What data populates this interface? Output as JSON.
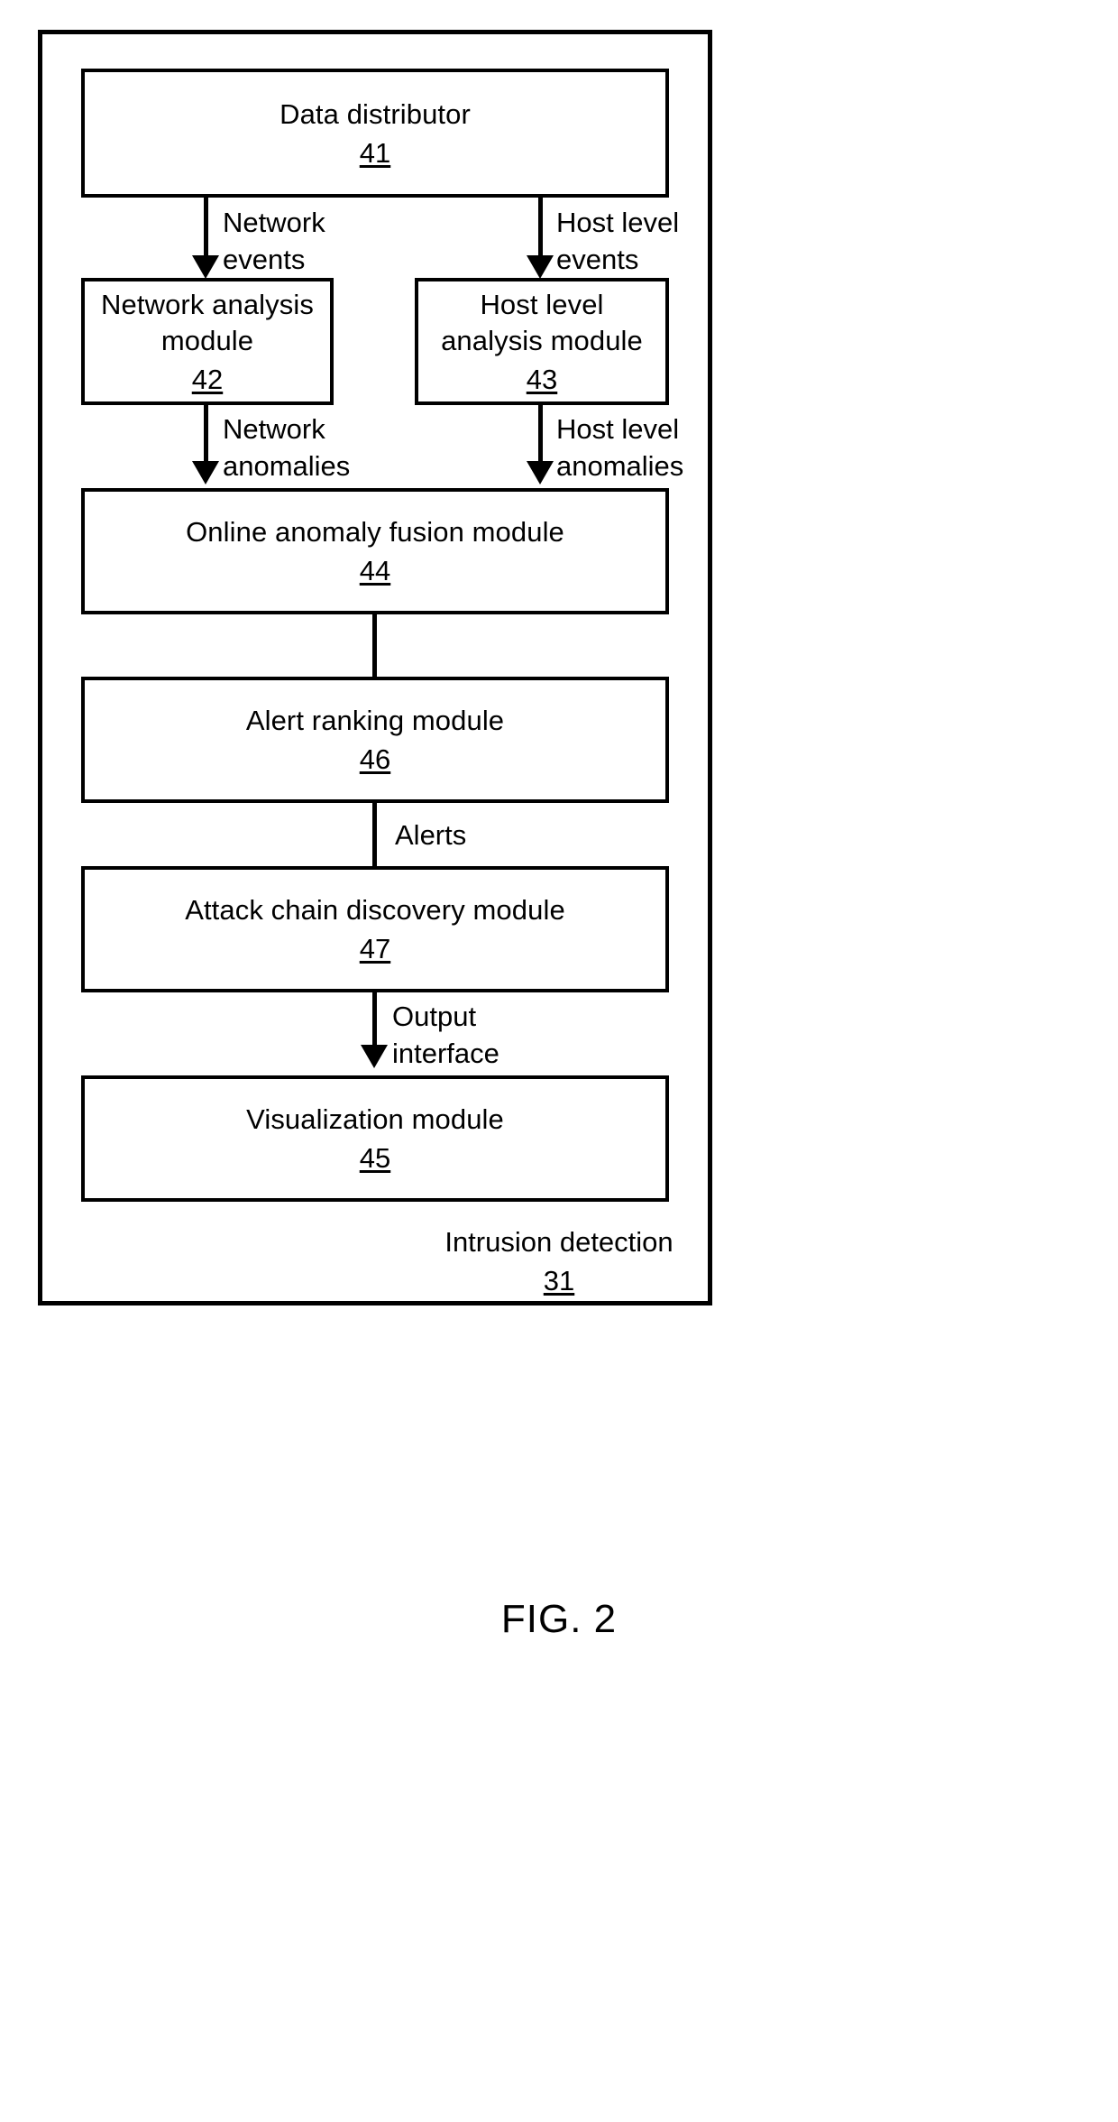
{
  "figure": {
    "caption": "FIG. 2",
    "container": {
      "label": "Intrusion detection",
      "number": "31"
    },
    "boxes": [
      {
        "id": "data-distributor",
        "title": "Data distributor",
        "number": "41"
      },
      {
        "id": "network-analysis",
        "title": "Network analysis\nmodule",
        "number": "42"
      },
      {
        "id": "host-level-analysis",
        "title": "Host level\nanalysis module",
        "number": "43"
      },
      {
        "id": "online-anomaly-fusion",
        "title": "Online anomaly fusion module",
        "number": "44"
      },
      {
        "id": "alert-ranking",
        "title": "Alert ranking module",
        "number": "46"
      },
      {
        "id": "attack-chain-discovery",
        "title": "Attack chain discovery module",
        "number": "47"
      },
      {
        "id": "visualization",
        "title": "Visualization module",
        "number": "45"
      }
    ],
    "edges": [
      {
        "id": "network-events",
        "label": "Network\nevents",
        "from": "41",
        "to": "42",
        "arrow": true
      },
      {
        "id": "host-level-events",
        "label": "Host level\nevents",
        "from": "41",
        "to": "43",
        "arrow": true
      },
      {
        "id": "network-anomalies",
        "label": "Network\nanomalies",
        "from": "42",
        "to": "44",
        "arrow": true
      },
      {
        "id": "host-level-anomalies",
        "label": "Host level\nanomalies",
        "from": "43",
        "to": "44",
        "arrow": true
      },
      {
        "id": "fusion-to-ranking",
        "label": "",
        "from": "44",
        "to": "46",
        "arrow": false
      },
      {
        "id": "alerts",
        "label": "Alerts",
        "from": "46",
        "to": "47",
        "arrow": false
      },
      {
        "id": "output-interface",
        "label": "Output\ninterface",
        "from": "47",
        "to": "45",
        "arrow": true
      }
    ],
    "colors": {
      "stroke": "#000000",
      "background": "#ffffff"
    }
  }
}
